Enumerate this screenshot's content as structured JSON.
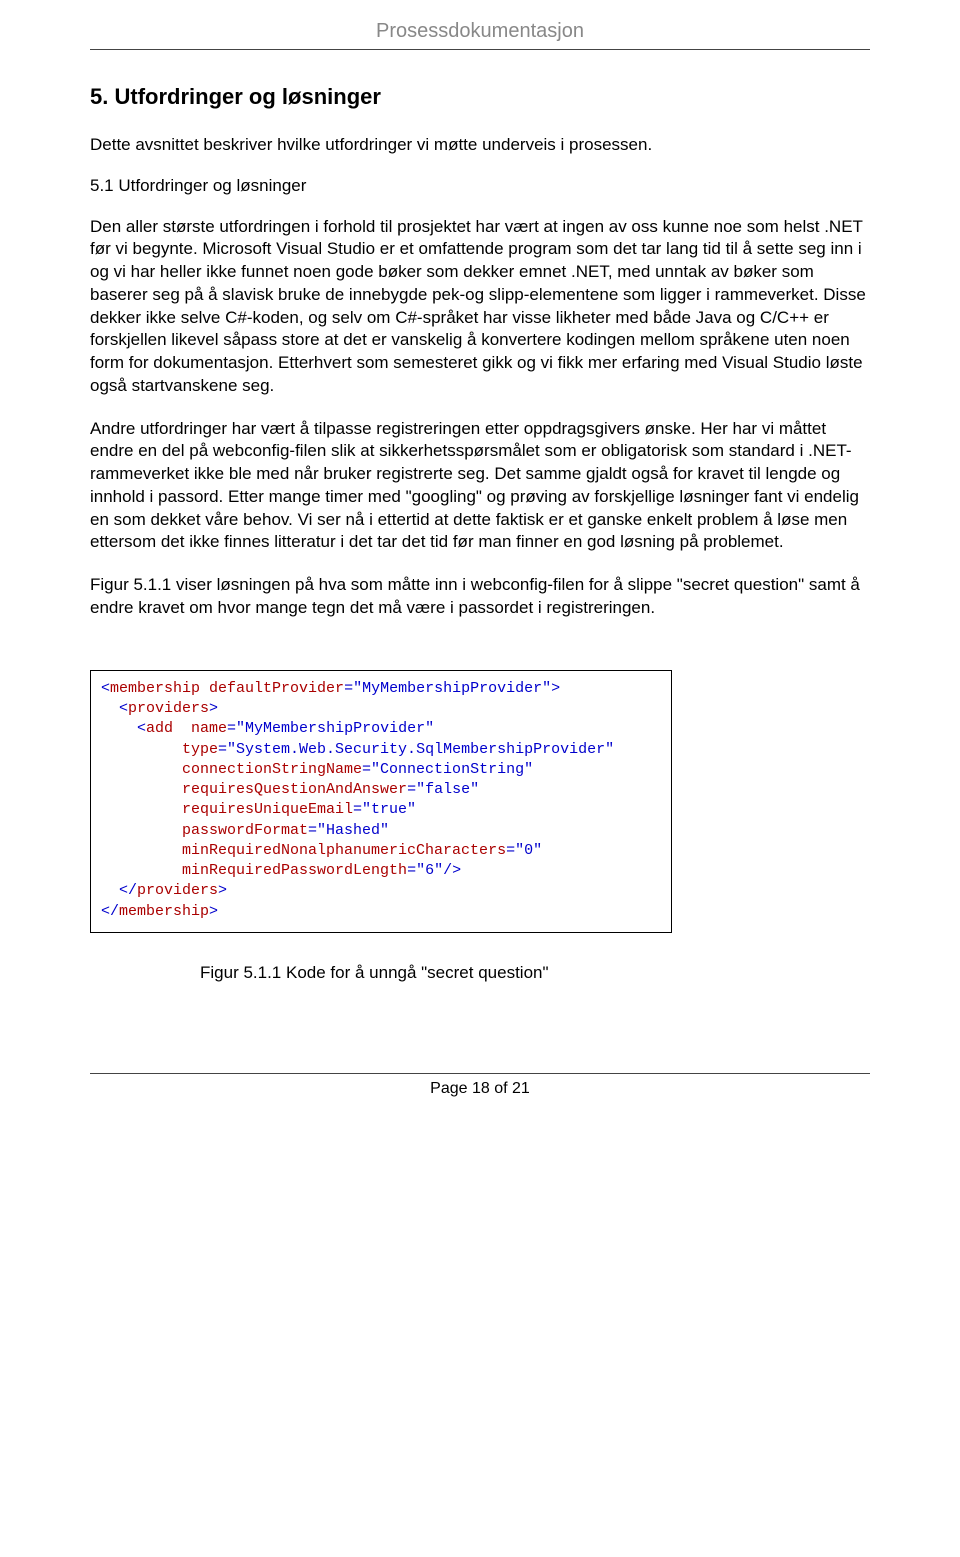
{
  "header": {
    "title": "Prosessdokumentasjon"
  },
  "section": {
    "number": "5.",
    "title": "Utfordringer og løsninger",
    "intro": "Dette avsnittet beskriver hvilke utfordringer vi møtte underveis i prosessen.",
    "sub_number": "5.1",
    "sub_title": "Utfordringer og løsninger",
    "p1": "Den aller største utfordringen i forhold til prosjektet har vært at ingen av oss kunne noe som helst .NET før vi begynte. Microsoft Visual Studio er et omfattende program som det tar lang tid til å sette seg inn i og vi har heller ikke funnet noen gode bøker som dekker emnet .NET, med unntak av bøker som baserer seg på å slavisk bruke de innebygde pek-og slipp-elementene som ligger i rammeverket. Disse dekker ikke selve C#-koden, og selv om C#-språket har visse likheter med både Java og C/C++ er forskjellen likevel såpass store at det er vanskelig å konvertere kodingen mellom språkene uten noen form for dokumentasjon. Etterhvert som semesteret gikk og vi fikk mer erfaring med Visual Studio løste også startvanskene seg.",
    "p2": "Andre utfordringer har vært å tilpasse registreringen etter oppdragsgivers ønske. Her har vi måttet endre en del på webconfig-filen slik at sikkerhetsspørsmålet som er obligatorisk som standard i .NET-rammeverket ikke ble med når bruker registrerte seg. Det samme gjaldt også for kravet til lengde og innhold i passord. Etter mange timer med \"googling\" og prøving av forskjellige løsninger fant vi endelig en som dekket våre behov. Vi ser nå i ettertid at dette faktisk er et ganske enkelt problem å løse men ettersom det ikke finnes litteratur i det tar det tid før man finner en god løsning på problemet.",
    "p3": "Figur 5.1.1 viser løsningen på hva som måtte inn i webconfig-filen for å slippe \"secret question\" samt å endre kravet om hvor mange tegn det må være i passordet i registreringen."
  },
  "code": {
    "l1_a": "<",
    "l1_b": "membership",
    "l1_c": " defaultProvider",
    "l1_d": "=\"MyMembershipProvider\">",
    "l2_a": "  <",
    "l2_b": "providers",
    "l2_c": ">",
    "l3_a": "    <",
    "l3_b": "add",
    "l3_c": "  name",
    "l3_d": "=\"MyMembershipProvider\"",
    "l4_a": "         type",
    "l4_b": "=\"System.Web.Security.SqlMembershipProvider\"",
    "l5_a": "         connectionStringName",
    "l5_b": "=\"ConnectionString\"",
    "l6_a": "         requiresQuestionAndAnswer",
    "l6_b": "=\"false\"",
    "l7_a": "         requiresUniqueEmail",
    "l7_b": "=\"true\"",
    "l8_a": "         passwordFormat",
    "l8_b": "=\"Hashed\"",
    "l9_a": "         minRequiredNonalphanumericCharacters",
    "l9_b": "=\"0\"",
    "l10_a": "         minRequiredPasswordLength",
    "l10_b": "=\"6\"/>",
    "l11_a": "  </",
    "l11_b": "providers",
    "l11_c": ">",
    "l12_a": "</",
    "l12_b": "membership",
    "l12_c": ">"
  },
  "figure": {
    "caption": "Figur 5.1.1 Kode for å unngå \"secret question\""
  },
  "footer": {
    "page": "Page 18 of 21"
  }
}
